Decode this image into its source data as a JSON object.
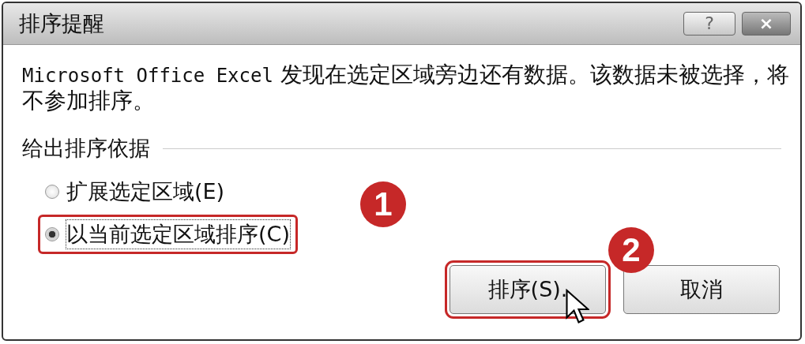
{
  "window": {
    "title": "排序提醒",
    "help": "?",
    "close": "×"
  },
  "message": {
    "lead": "Microsoft Office Excel",
    "text": "发现在选定区域旁边还有数据。该数据未被选择，将不参加排序。"
  },
  "group": {
    "label": "给出排序依据"
  },
  "options": [
    {
      "label": "扩展选定区域(E)",
      "selected": false,
      "highlighted": false
    },
    {
      "label": "以当前选定区域排序(C)",
      "selected": true,
      "highlighted": true
    }
  ],
  "buttons": [
    {
      "label": "排序(S).",
      "highlighted": true
    },
    {
      "label": "取消",
      "highlighted": false
    }
  ],
  "callouts": [
    "1",
    "2"
  ]
}
